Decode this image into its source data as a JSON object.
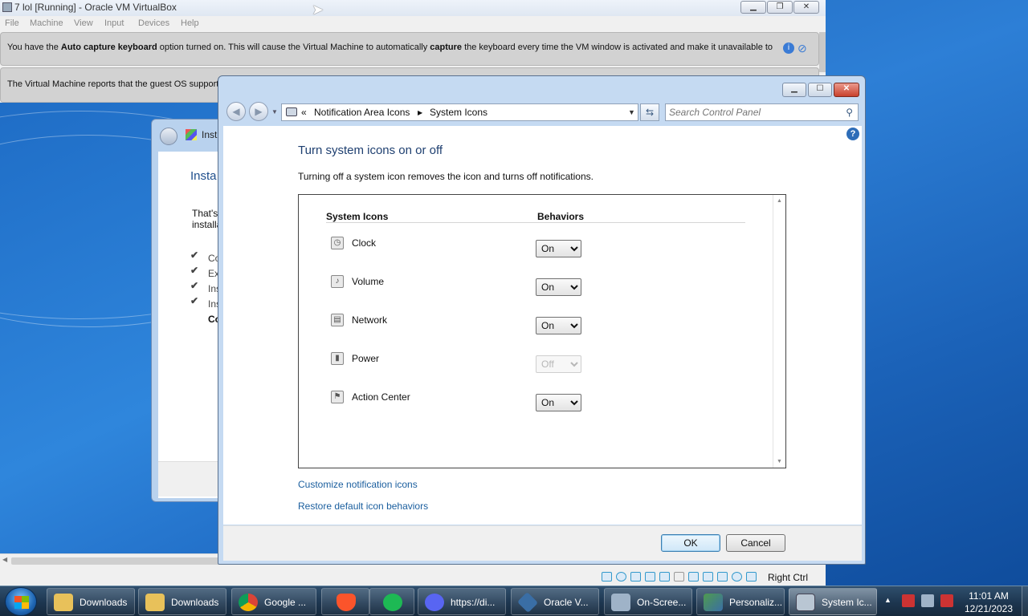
{
  "vbox": {
    "title": "7 lol [Running] - Oracle VM VirtualBox",
    "menu": [
      "File",
      "Machine",
      "View",
      "Input",
      "Devices",
      "Help"
    ],
    "banner1": {
      "pre": "You have the ",
      "bold1": "Auto capture keyboard",
      "mid": " option turned on. This will cause the Virtual Machine to automatically ",
      "bold2": "capture",
      "post": " the keyboard every time the VM window is activated and make it unavailable to"
    },
    "banner2": {
      "text": "The Virtual Machine reports that the guest OS supports"
    },
    "host_key": "Right Ctrl"
  },
  "installer": {
    "title": "Inst",
    "heading": "Insta",
    "para_line1": "That's",
    "para_line2": "installa",
    "steps": [
      "Co",
      "Ex",
      "Ins",
      "Ins",
      "Co"
    ]
  },
  "dialog": {
    "breadcrumb": {
      "sep": "«",
      "item1": "Notification Area Icons",
      "item2": "System Icons"
    },
    "search_placeholder": "Search Control Panel",
    "page_title": "Turn system icons on or off",
    "description": "Turning off a system icon removes the icon and turns off notifications.",
    "col_icons": "System Icons",
    "col_behaviors": "Behaviors",
    "rows": [
      {
        "label": "Clock",
        "value": "On",
        "enabled": true
      },
      {
        "label": "Volume",
        "value": "On",
        "enabled": true
      },
      {
        "label": "Network",
        "value": "On",
        "enabled": true
      },
      {
        "label": "Power",
        "value": "Off",
        "enabled": false
      },
      {
        "label": "Action Center",
        "value": "On",
        "enabled": true
      }
    ],
    "link_customize": "Customize notification icons",
    "link_restore": "Restore default icon behaviors",
    "ok": "OK",
    "cancel": "Cancel"
  },
  "taskbar": {
    "buttons": [
      {
        "label": "Downloads",
        "icon": "folder-icon",
        "color": "#e8c15a"
      },
      {
        "label": "Downloads",
        "icon": "folder-icon",
        "color": "#e8c15a"
      },
      {
        "label": "Google ...",
        "icon": "chrome-icon",
        "color": "#db4437"
      },
      {
        "label": "",
        "icon": "brave-icon",
        "color": "#fb542b"
      },
      {
        "label": "",
        "icon": "spotify-icon",
        "color": "#1db954"
      },
      {
        "label": "https://di...",
        "icon": "discord-icon",
        "color": "#5865f2"
      },
      {
        "label": "Oracle V...",
        "icon": "virtualbox-icon",
        "color": "#3a6ea5"
      },
      {
        "label": "On-Scree...",
        "icon": "keyboard-icon",
        "color": "#9fb3c8"
      },
      {
        "label": "Personaliz...",
        "icon": "personalize-icon",
        "color": "#4f9a4f"
      },
      {
        "label": "System Ic...",
        "icon": "control-panel-icon",
        "color": "#b9c6d3"
      }
    ],
    "clock_time": "11:01 AM",
    "clock_date": "12/21/2023"
  }
}
